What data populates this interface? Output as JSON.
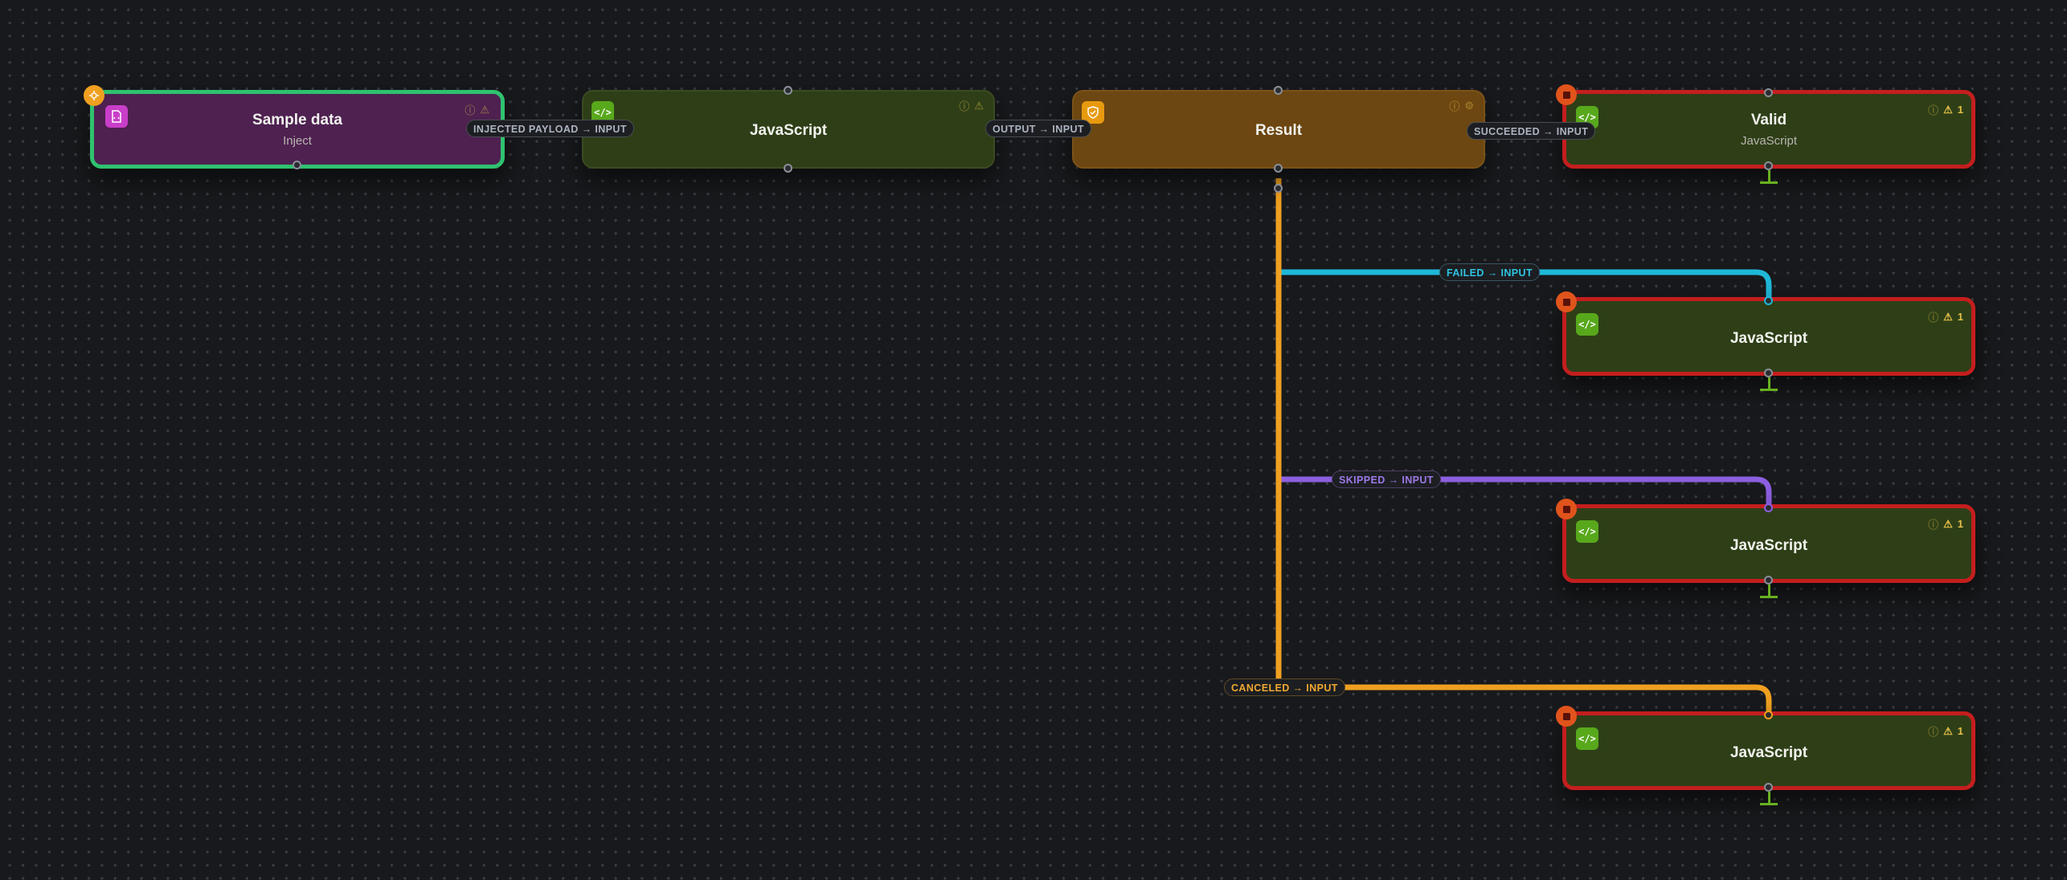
{
  "nodes": {
    "sample_data": {
      "title": "Sample data",
      "subtitle": "Inject",
      "icon": "file-code-icon",
      "badge_icon": "trigger-icon"
    },
    "js1": {
      "title": "JavaScript",
      "icon": "code-icon"
    },
    "result": {
      "title": "Result",
      "icon": "shield-check-icon"
    },
    "valid": {
      "title": "Valid",
      "subtitle": "JavaScript",
      "icon": "code-icon",
      "warning_count": "1",
      "badge_icon": "stop-icon"
    },
    "js_failed": {
      "title": "JavaScript",
      "icon": "code-icon",
      "warning_count": "1",
      "badge_icon": "stop-icon"
    },
    "js_skipped": {
      "title": "JavaScript",
      "icon": "code-icon",
      "warning_count": "1",
      "badge_icon": "stop-icon"
    },
    "js_canceled": {
      "title": "JavaScript",
      "icon": "code-icon",
      "warning_count": "1",
      "badge_icon": "stop-icon"
    }
  },
  "edges": {
    "injected": "INJECTED PAYLOAD → INPUT",
    "output": "OUTPUT → INPUT",
    "succeeded": "SUCCEEDED → INPUT",
    "failed": "FAILED → INPUT",
    "skipped": "SKIPPED → INPUT",
    "canceled": "CANCELED → INPUT"
  },
  "colors": {
    "canvas_bg": "#18191c",
    "failed_edge": "#1fb8d8",
    "skipped_edge": "#8c5fe0",
    "canceled_edge": "#f0a020",
    "error_border": "#c41e1e",
    "inject_border": "#2ec26f"
  }
}
